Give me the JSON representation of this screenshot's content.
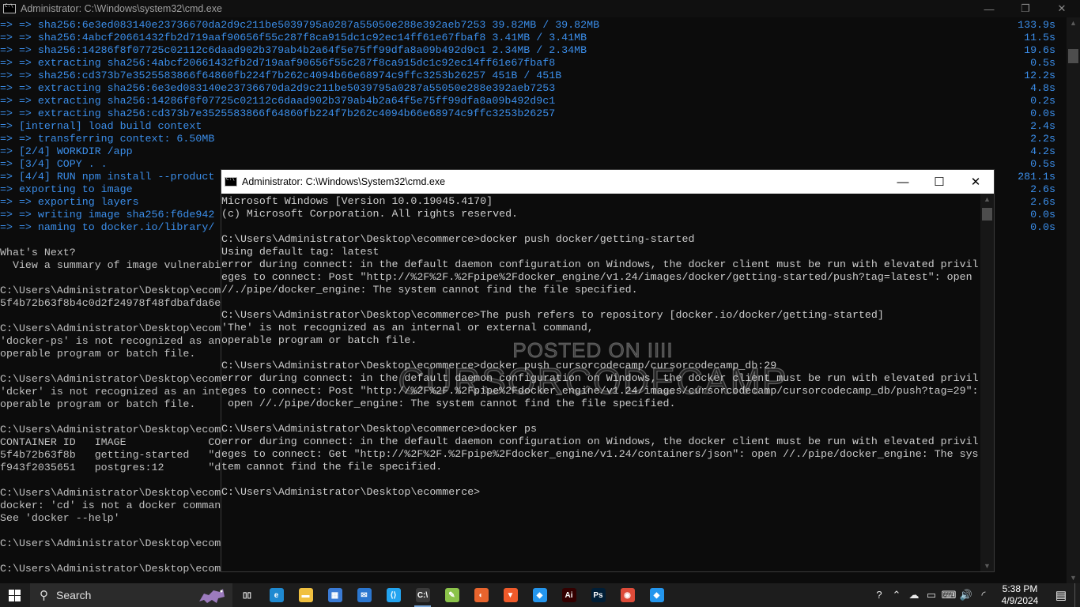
{
  "bg_window": {
    "title": "Administrator: C:\\Windows\\system32\\cmd.exe",
    "minimize": "—",
    "restore": "❐",
    "close": "✕",
    "lines": [
      {
        "text": "=> => sha256:6e3ed083140e23736670da2d9c211be5039795a0287a55050e288e392aeb7253 39.82MB / 39.82MB",
        "time": "133.9s",
        "style": "blue"
      },
      {
        "text": "=> => sha256:4abcf20661432fb2d719aaf90656f55c287f8ca915dc1c92ec14ff61e67fbaf8 3.41MB / 3.41MB",
        "time": "11.5s",
        "style": "blue"
      },
      {
        "text": "=> => sha256:14286f8f07725c02112c6daad902b379ab4b2a64f5e75ff99dfa8a09b492d9c1 2.34MB / 2.34MB",
        "time": "19.6s",
        "style": "blue"
      },
      {
        "text": "=> => extracting sha256:4abcf20661432fb2d719aaf90656f55c287f8ca915dc1c92ec14ff61e67fbaf8",
        "time": "0.5s",
        "style": "blue"
      },
      {
        "text": "=> => sha256:cd373b7e3525583866f64860fb224f7b262c4094b66e68974c9ffc3253b26257 451B / 451B",
        "time": "12.2s",
        "style": "blue"
      },
      {
        "text": "=> => extracting sha256:6e3ed083140e23736670da2d9c211be5039795a0287a55050e288e392aeb7253",
        "time": "4.8s",
        "style": "blue"
      },
      {
        "text": "=> => extracting sha256:14286f8f07725c02112c6daad902b379ab4b2a64f5e75ff99dfa8a09b492d9c1",
        "time": "0.2s",
        "style": "blue"
      },
      {
        "text": "=> => extracting sha256:cd373b7e3525583866f64860fb224f7b262c4094b66e68974c9ffc3253b26257",
        "time": "0.0s",
        "style": "blue"
      },
      {
        "text": "=> [internal] load build context",
        "time": "2.4s",
        "style": "blue"
      },
      {
        "text": "=> => transferring context: 6.50MB",
        "time": "2.2s",
        "style": "blue"
      },
      {
        "text": "=> [2/4] WORKDIR /app",
        "time": "4.2s",
        "style": "blue"
      },
      {
        "text": "=> [3/4] COPY . .",
        "time": "0.5s",
        "style": "blue"
      },
      {
        "text": "=> [4/4] RUN npm install --product",
        "time": "281.1s",
        "style": "blue"
      },
      {
        "text": "=> exporting to image",
        "time": "2.6s",
        "style": "blue"
      },
      {
        "text": "=> => exporting layers",
        "time": "2.6s",
        "style": "blue"
      },
      {
        "text": "=> => writing image sha256:f6de942",
        "time": "0.0s",
        "style": "blue"
      },
      {
        "text": "=> => naming to docker.io/library/",
        "time": "0.0s",
        "style": "blue"
      },
      {
        "text": "",
        "time": "",
        "style": "plain"
      },
      {
        "text": "What's Next?",
        "time": "",
        "style": "plain"
      },
      {
        "text": "  View a summary of image vulnerabi",
        "time": "",
        "style": "plain"
      },
      {
        "text": "",
        "time": "",
        "style": "plain"
      },
      {
        "text": "C:\\Users\\Administrator\\Desktop\\ecom",
        "time": "",
        "style": "plain"
      },
      {
        "text": "5f4b72b63f8b4c0d2f24978f48fdbafda6e",
        "time": "",
        "style": "plain"
      },
      {
        "text": "",
        "time": "",
        "style": "plain"
      },
      {
        "text": "C:\\Users\\Administrator\\Desktop\\ecom",
        "time": "",
        "style": "plain"
      },
      {
        "text": "'docker-ps' is not recognized as an",
        "time": "",
        "style": "plain"
      },
      {
        "text": "operable program or batch file.",
        "time": "",
        "style": "plain"
      },
      {
        "text": "",
        "time": "",
        "style": "plain"
      },
      {
        "text": "C:\\Users\\Administrator\\Desktop\\ecom",
        "time": "",
        "style": "plain"
      },
      {
        "text": "'dcker' is not recognized as an int",
        "time": "",
        "style": "plain"
      },
      {
        "text": "operable program or batch file.",
        "time": "",
        "style": "plain"
      },
      {
        "text": "",
        "time": "",
        "style": "plain"
      },
      {
        "text": "C:\\Users\\Administrator\\Desktop\\ecom",
        "time": "",
        "style": "plain"
      },
      {
        "text": "CONTAINER ID   IMAGE             CO",
        "time": "",
        "style": "plain"
      },
      {
        "text": "5f4b72b63f8b   getting-started   \"d",
        "time": "",
        "style": "plain"
      },
      {
        "text": "f943f2035651   postgres:12       \"d",
        "time": "",
        "style": "plain"
      },
      {
        "text": "",
        "time": "",
        "style": "plain"
      },
      {
        "text": "C:\\Users\\Administrator\\Desktop\\ecom",
        "time": "",
        "style": "plain"
      },
      {
        "text": "docker: 'cd' is not a docker comman",
        "time": "",
        "style": "plain"
      },
      {
        "text": "See 'docker --help'",
        "time": "",
        "style": "plain"
      },
      {
        "text": "",
        "time": "",
        "style": "plain"
      },
      {
        "text": "C:\\Users\\Administrator\\Desktop\\ecom",
        "time": "",
        "style": "plain"
      },
      {
        "text": "",
        "time": "",
        "style": "plain"
      },
      {
        "text": "C:\\Users\\Administrator\\Desktop\\ecom",
        "time": "",
        "style": "plain"
      }
    ]
  },
  "fg_window": {
    "title": "Administrator: C:\\Windows\\System32\\cmd.exe",
    "minimize": "—",
    "maximize": "☐",
    "close": "✕",
    "lines": [
      "Microsoft Windows [Version 10.0.19045.4170]",
      "(c) Microsoft Corporation. All rights reserved.",
      "",
      "C:\\Users\\Administrator\\Desktop\\ecommerce>docker push docker/getting-started",
      "Using default tag: latest",
      "error during connect: in the default daemon configuration on Windows, the docker client must be run with elevated privil",
      "eges to connect: Post \"http://%2F%2F.%2Fpipe%2Fdocker_engine/v1.24/images/docker/getting-started/push?tag=latest\": open",
      "//./pipe/docker_engine: The system cannot find the file specified.",
      "",
      "C:\\Users\\Administrator\\Desktop\\ecommerce>The push refers to repository [docker.io/docker/getting-started]",
      "'The' is not recognized as an internal or external command,",
      "operable program or batch file.",
      "",
      "C:\\Users\\Administrator\\Desktop\\ecommerce>docker push cursorcodecamp/cursorcodecamp_db:29",
      "error during connect: in the default daemon configuration on Windows, the docker client must be run with elevated privil",
      "eges to connect: Post \"http://%2F%2F.%2Fpipe%2Fdocker_engine/v1.24/images/cursorcodecamp/cursorcodecamp_db/push?tag=29\":",
      " open //./pipe/docker_engine: The system cannot find the file specified.",
      "",
      "C:\\Users\\Administrator\\Desktop\\ecommerce>docker ps",
      "error during connect: in the default daemon configuration on Windows, the docker client must be run with elevated privil",
      "eges to connect: Get \"http://%2F%2F.%2Fpipe%2Fdocker_engine/v1.24/containers/json\": open //./pipe/docker_engine: The sys",
      "tem cannot find the file specified.",
      "",
      "C:\\Users\\Administrator\\Desktop\\ecommerce>"
    ]
  },
  "watermark": {
    "line1": "POSTED ON IIII",
    "line2": "CURSORCODECAMP"
  },
  "taskbar": {
    "search_label": "Search",
    "search_glyph": "⚲",
    "apps": [
      {
        "name": "task-view-icon",
        "glyph": "▯▯",
        "color": "#1d1d1d"
      },
      {
        "name": "edge-icon",
        "glyph": "e",
        "color": "#1f8ad1"
      },
      {
        "name": "file-explorer-icon",
        "glyph": "▬",
        "color": "#f0c040"
      },
      {
        "name": "microsoft-store-icon",
        "glyph": "▦",
        "color": "#3a7bd5"
      },
      {
        "name": "mail-icon",
        "glyph": "✉",
        "color": "#2b77d0"
      },
      {
        "name": "vscode-icon",
        "glyph": "⟨⟩",
        "color": "#23a4f0"
      },
      {
        "name": "cmd-icon",
        "glyph": "C:\\",
        "color": "#3a3a3a"
      },
      {
        "name": "notepad-icon",
        "glyph": "✎",
        "color": "#8bc34a"
      },
      {
        "name": "app-orange-icon",
        "glyph": "◐",
        "color": "#e8642d"
      },
      {
        "name": "brave-icon",
        "glyph": "▼",
        "color": "#f05a2a"
      },
      {
        "name": "docker-desktop-icon",
        "glyph": "◆",
        "color": "#2496ed"
      },
      {
        "name": "illustrator-icon",
        "glyph": "Ai",
        "color": "#330000"
      },
      {
        "name": "photoshop-icon",
        "glyph": "Ps",
        "color": "#001e36"
      },
      {
        "name": "chrome-icon",
        "glyph": "◉",
        "color": "#dd4b39"
      },
      {
        "name": "docker-icon",
        "glyph": "◆",
        "color": "#2496ed"
      }
    ],
    "tray": [
      "?",
      "⌃",
      "☁",
      "▭",
      "⌨",
      "🔊",
      "◜"
    ],
    "time": "5:38 PM",
    "date": "4/9/2024",
    "notification_glyph": "▤"
  }
}
